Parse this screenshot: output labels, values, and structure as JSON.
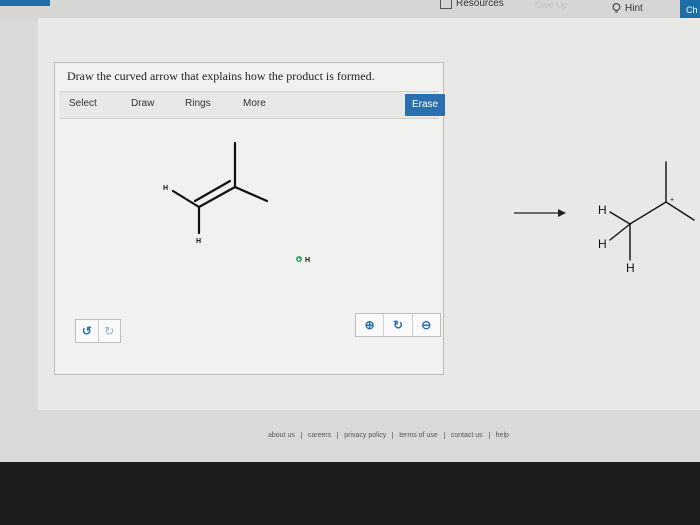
{
  "topbar": {
    "resources_label": "Resources",
    "faded_tab_label": "Give Up",
    "hint_label": "Hint",
    "check_label": "Ch"
  },
  "question": {
    "prompt": "Draw the curved arrow that explains how the product is formed."
  },
  "toolbar": {
    "select": "Select",
    "draw": "Draw",
    "rings": "Rings",
    "more": "More",
    "erase": "Erase"
  },
  "reactant": {
    "h_left": "H",
    "h_bottom": "H",
    "proton": "H",
    "proton_charge": "+"
  },
  "product": {
    "h_top": "H",
    "h_mid": "H",
    "h_bottom": "H",
    "charge": "+"
  },
  "controls": {
    "undo_icon": "undo-icon",
    "redo_icon": "redo-icon",
    "zoom_in_icon": "zoom-in-icon",
    "reset_icon": "reset-icon",
    "zoom_out_icon": "zoom-out-icon"
  },
  "footer": {
    "links": [
      "about us",
      "careers",
      "privacy policy",
      "terms of use",
      "contact us",
      "help"
    ]
  },
  "colors": {
    "accent": "#2a6fb0",
    "proton_green": "#3aa66a"
  }
}
